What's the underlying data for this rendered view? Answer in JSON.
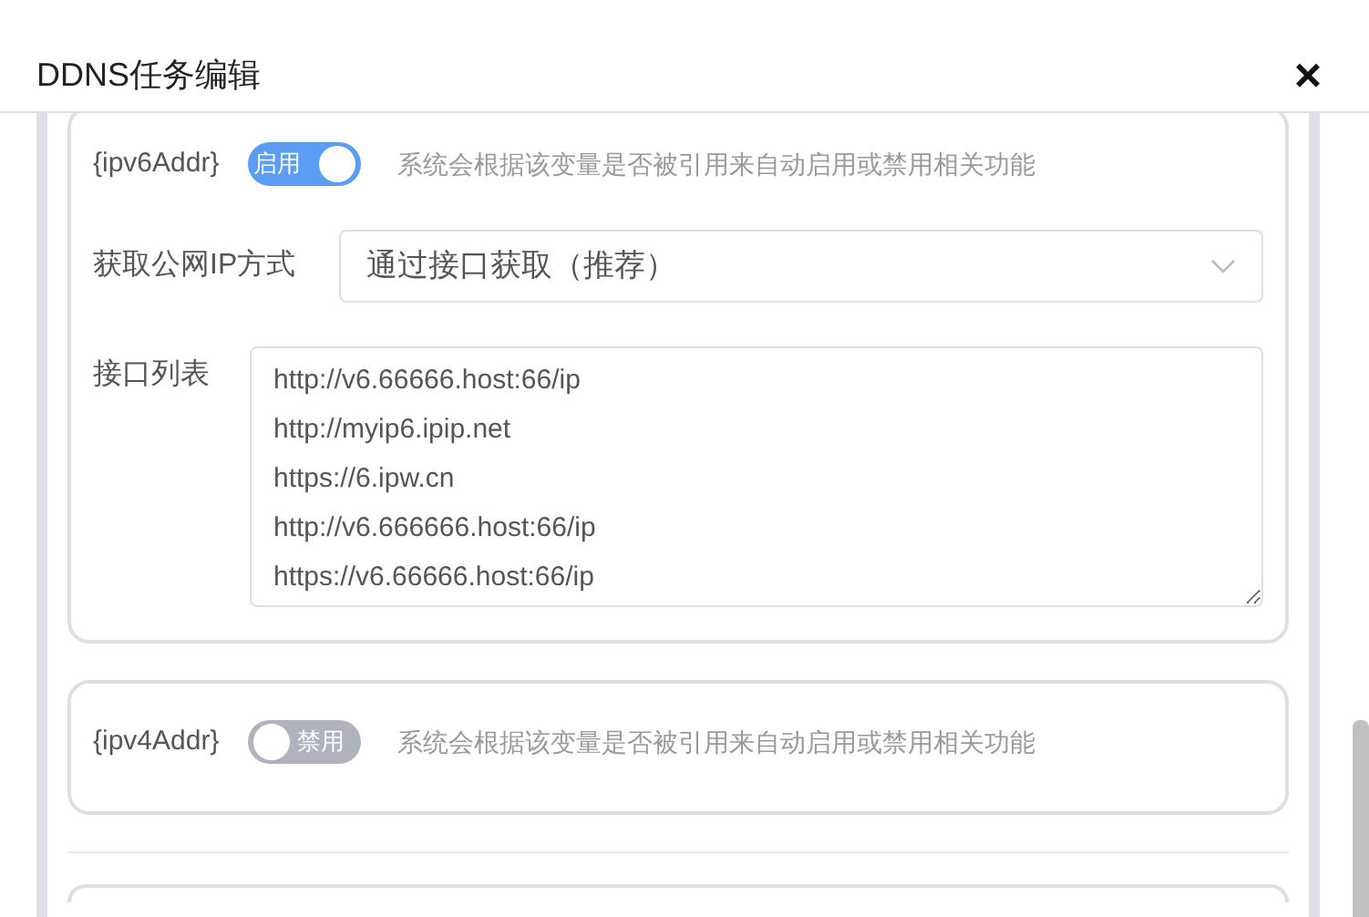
{
  "dialog": {
    "title": "DDNS任务编辑",
    "close": "×"
  },
  "variables": [
    {
      "name": "{ipv6Addr}",
      "on": true,
      "switch_label": "启用",
      "hint": "系统会根据该变量是否被引用来自动启用或禁用相关功能",
      "method_label": "获取公网IP方式",
      "method_value": "通过接口获取（推荐）",
      "interfaces_label": "接口列表",
      "interfaces": [
        "http://v6.66666.host:66/ip",
        "http://myip6.ipip.net",
        "https://6.ipw.cn",
        "http://v6.666666.host:66/ip",
        "https://v6.66666.host:66/ip"
      ]
    },
    {
      "name": "{ipv4Addr}",
      "on": false,
      "switch_label": "禁用",
      "hint": "系统会根据该变量是否被引用来自动启用或禁用相关功能"
    }
  ]
}
